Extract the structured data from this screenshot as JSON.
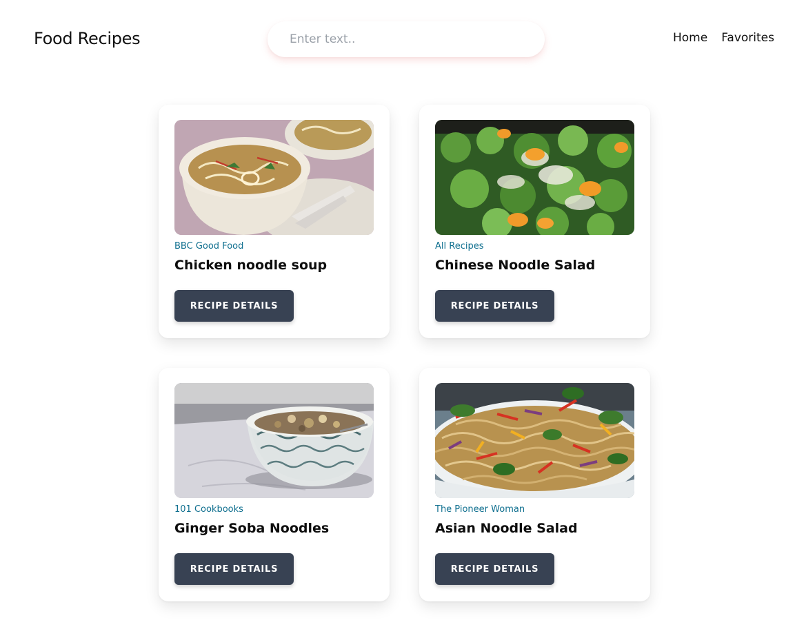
{
  "header": {
    "brand": "Food Recipes",
    "search_placeholder": "Enter text..",
    "search_value": "",
    "nav": [
      "Home",
      "Favorites"
    ]
  },
  "recipes": [
    {
      "source": "BBC Good Food",
      "title": "Chicken noodle soup",
      "button": "RECIPE DETAILS",
      "image": "chicken-noodle-soup-photo"
    },
    {
      "source": "All Recipes",
      "title": "Chinese Noodle Salad",
      "button": "RECIPE DETAILS",
      "image": "chinese-noodle-salad-photo"
    },
    {
      "source": "101 Cookbooks",
      "title": "Ginger Soba Noodles",
      "button": "RECIPE DETAILS",
      "image": "ginger-soba-noodles-photo"
    },
    {
      "source": "The Pioneer Woman",
      "title": "Asian Noodle Salad",
      "button": "RECIPE DETAILS",
      "image": "asian-noodle-salad-photo"
    }
  ],
  "colors": {
    "source_link": "#0f6f8f",
    "button_bg": "#384253",
    "button_text": "#ffffff"
  }
}
